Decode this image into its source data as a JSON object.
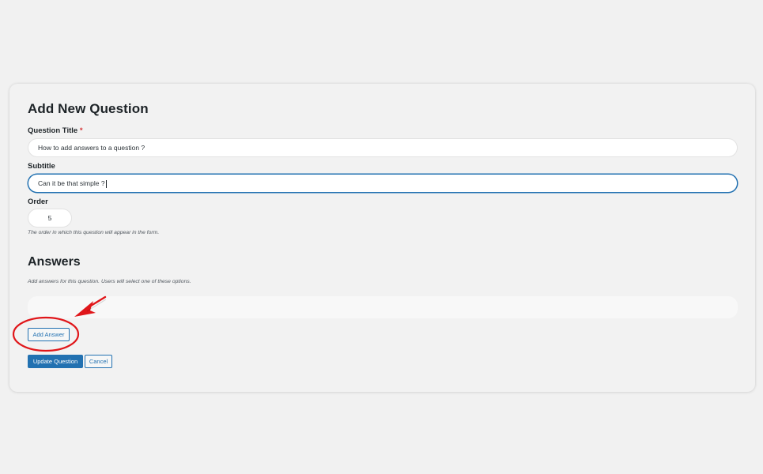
{
  "form": {
    "title": "Add New Question",
    "question_title": {
      "label": "Question Title",
      "required_mark": "*",
      "value": "How to add answers to a question ?"
    },
    "subtitle": {
      "label": "Subtitle",
      "value": "Can it be that simple ?"
    },
    "order": {
      "label": "Order",
      "value": "5",
      "description": "The order in which this question will appear in the form."
    }
  },
  "answers": {
    "title": "Answers",
    "description": "Add answers for this question. Users will select one of these options.",
    "add_button": "Add Answer"
  },
  "actions": {
    "update": "Update Question",
    "cancel": "Cancel"
  },
  "colors": {
    "accent": "#2271b1",
    "required": "#d63638",
    "annotation": "#e0161a"
  }
}
